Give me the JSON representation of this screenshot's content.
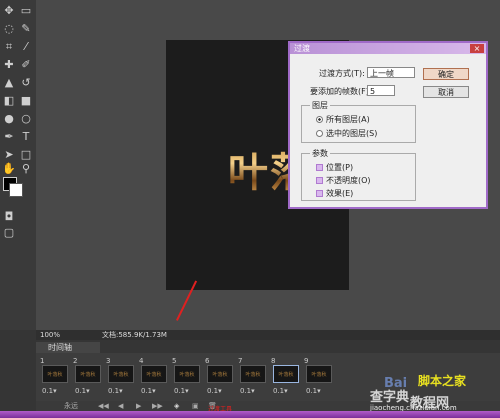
{
  "dialog": {
    "title": "过渡",
    "close": "×",
    "transition_with_label": "过渡方式(T):",
    "transition_with_value": "上一帧",
    "frames_to_add_label": "要添加的帧数(F):",
    "frames_to_add_value": "5",
    "ok_button": "确定",
    "cancel_button": "取消",
    "layers_group_title": "图层",
    "all_layers": "所有图层(A)",
    "selected_layer": "选中的图层(S)",
    "params_group_title": "参数",
    "position": "位置(P)",
    "opacity": "不透明度(O)",
    "effects": "效果(E)"
  },
  "canvas": {
    "text": "叶落"
  },
  "statusbar": {
    "zoom": "100%",
    "doc_info": "文档:585.9K/1.73M"
  },
  "timeline": {
    "tab_label": "时间轴",
    "frames": [
      {
        "num": "1",
        "delay": "0.1▾",
        "thumb": "叶落秋"
      },
      {
        "num": "2",
        "delay": "0.1▾",
        "thumb": "叶落秋"
      },
      {
        "num": "3",
        "delay": "0.1▾",
        "thumb": "叶落秋"
      },
      {
        "num": "4",
        "delay": "0.1▾",
        "thumb": "叶落秋"
      },
      {
        "num": "5",
        "delay": "0.1▾",
        "thumb": "叶落秋"
      },
      {
        "num": "6",
        "delay": "0.1▾",
        "thumb": "叶落秋"
      },
      {
        "num": "7",
        "delay": "0.1▾",
        "thumb": "叶落秋"
      },
      {
        "num": "8",
        "delay": "0.1▾",
        "thumb": "叶落秋"
      },
      {
        "num": "9",
        "delay": "0.1▾",
        "thumb": "叶落秋"
      }
    ],
    "loop": "永远",
    "controls": {
      "first": "◀◀",
      "prev": "◀",
      "play": "▶",
      "next": "▶▶",
      "tween": "◈",
      "new": "▣",
      "delete": "🗑"
    }
  },
  "annotation": {
    "text": "过渡工具"
  },
  "watermark": {
    "line1": "查字典",
    "line2": "教程网",
    "line3": "jiaocheng.chazidian.com",
    "brand": "脚本之家",
    "baidu": "Bai"
  },
  "colors": {
    "dialog_border": "#a06ac8",
    "taskbar": "#8a3aab",
    "annotation": "#e02020"
  }
}
